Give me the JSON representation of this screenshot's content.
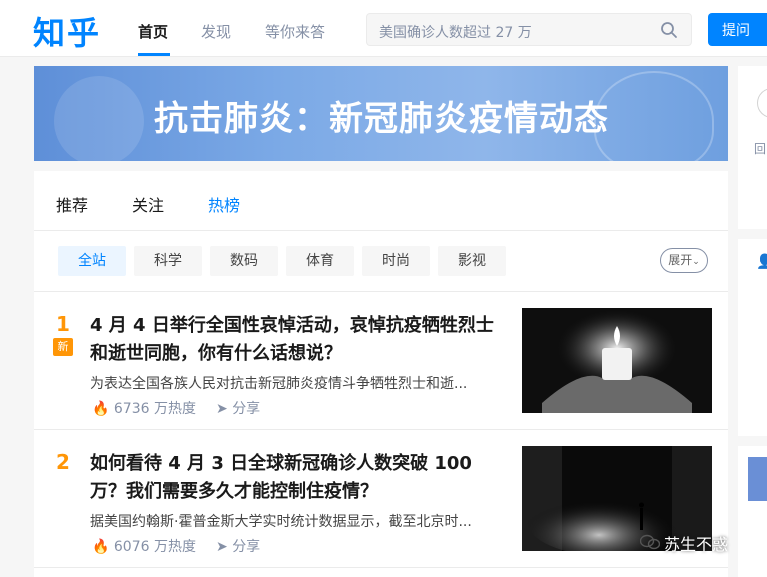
{
  "header": {
    "logo": "知乎",
    "nav": [
      "首页",
      "发现",
      "等你来答"
    ],
    "search_placeholder": "美国确诊人数超过 27 万",
    "ask_label": "提问"
  },
  "banner": {
    "title": "抗击肺炎：新冠肺炎疫情动态"
  },
  "tabs": [
    "推荐",
    "关注",
    "热榜"
  ],
  "filters": [
    "全站",
    "科学",
    "数码",
    "体育",
    "时尚",
    "影视"
  ],
  "expand_label": "展开",
  "hot_items": [
    {
      "rank": "1",
      "badge": "新",
      "title": "4 月 4 日举行全国性哀悼活动，哀悼抗疫牺牲烈士和逝世同胞，你有什么话想说？",
      "excerpt": "为表达全国各族人民对抗击新冠肺炎疫情斗争牺牲烈士和逝...",
      "heat": "6736 万热度",
      "share": "分享"
    },
    {
      "rank": "2",
      "badge": "",
      "title": "如何看待 4 月 3 日全球新冠确诊人数突破 100 万？我们需要多久才能控制住疫情？",
      "excerpt": "据美国约翰斯·霍普金斯大学实时统计数据显示，截至北京时...",
      "heat": "6076 万热度",
      "share": "分享"
    }
  ],
  "sidebar": {
    "partial_label": "回"
  },
  "watermark": "苏生不惑",
  "colors": {
    "brand": "#0084ff",
    "rank": "#ff9607"
  }
}
